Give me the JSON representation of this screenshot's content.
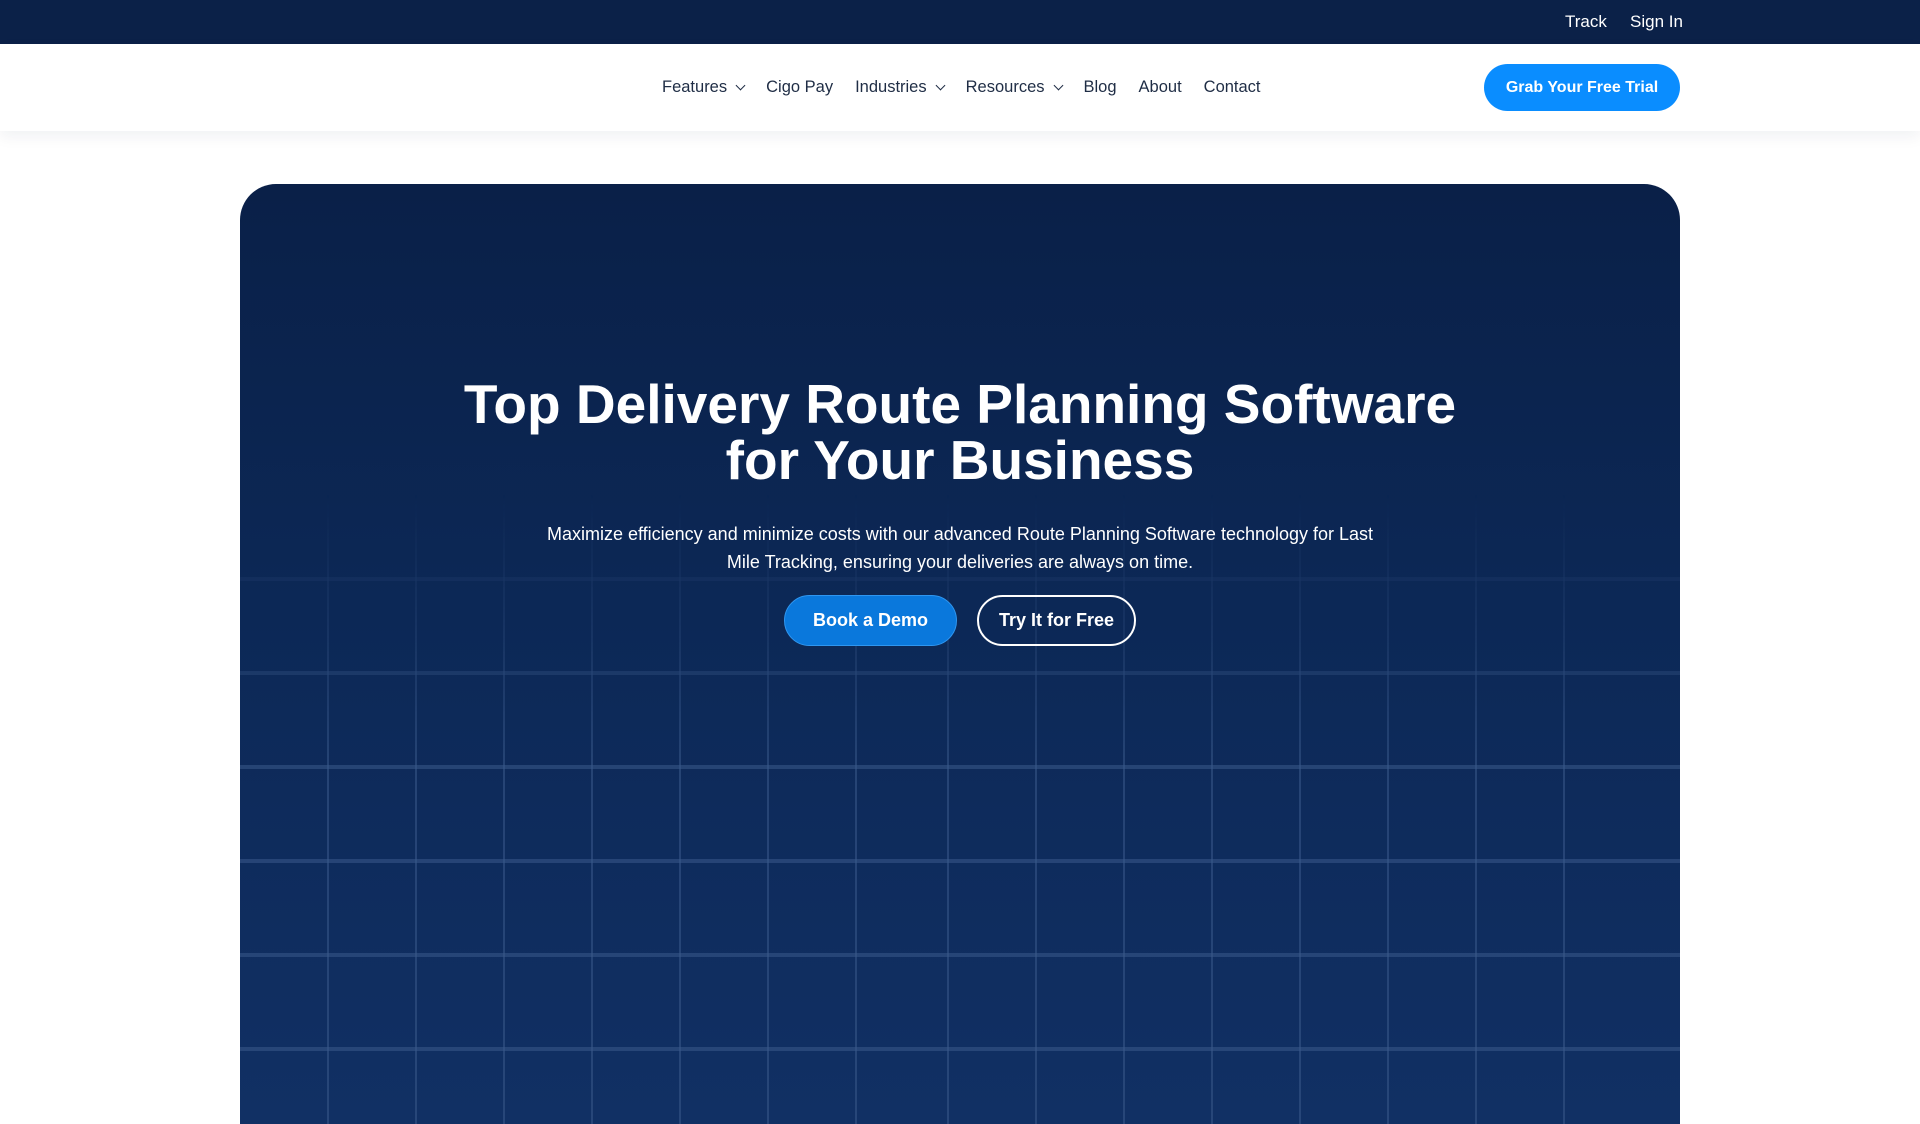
{
  "topbar": {
    "links": [
      "Track",
      "Sign In"
    ]
  },
  "nav": {
    "items": [
      {
        "label": "Features",
        "dropdown": true
      },
      {
        "label": "Cigo Pay",
        "dropdown": false
      },
      {
        "label": "Industries",
        "dropdown": true
      },
      {
        "label": "Resources",
        "dropdown": true
      },
      {
        "label": "Blog",
        "dropdown": false
      },
      {
        "label": "About",
        "dropdown": false
      },
      {
        "label": "Contact",
        "dropdown": false
      }
    ],
    "cta_label": "Grab Your Free Trial"
  },
  "hero": {
    "title_line1": "Top Delivery Route Planning Software",
    "title_line2": "for Your Business",
    "subtitle": "Maximize efficiency and minimize costs with our advanced Route Planning Software technology for Last Mile Tracking, ensuring your deliveries are always on time.",
    "primary_button": "Book a Demo",
    "secondary_button": "Try It for Free"
  },
  "colors": {
    "topbar_bg": "#0b2148",
    "hero_bg": "#0c2856",
    "accent": "#0a8dff",
    "demo_button": "#0a78dc"
  }
}
